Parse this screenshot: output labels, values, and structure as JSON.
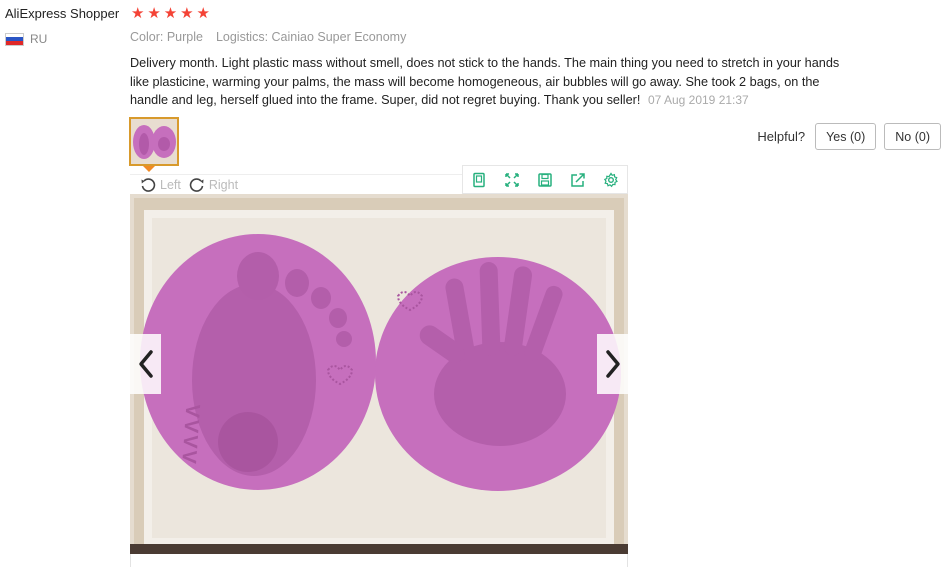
{
  "review": {
    "user_name": "AliExpress Shopper",
    "rating": 5,
    "country_code": "RU",
    "color": "Color: Purple",
    "logistics": "Logistics: Cainiao Super Economy",
    "text": "Delivery month. Light plastic mass without smell, does not stick to the hands. The main thing you need to stretch in your hands like plasticine, warming your palms, the mass will become homogeneous, air bubbles will go away. She took 2 bags, on the handle and leg, herself glued into the frame. Super, did not regret buying. Thank you seller!",
    "date": "07 Aug 2019 21:37"
  },
  "helpful": {
    "label": "Helpful?",
    "yes": "Yes (0)",
    "no": "No (0)"
  },
  "viewer": {
    "rotate_left": "Left",
    "rotate_right": "Right"
  },
  "colors": {
    "star": "#f44336",
    "thumb_border": "#d89a2c",
    "toolbar_icon": "#27b07e",
    "clay": "#c66fbd"
  }
}
